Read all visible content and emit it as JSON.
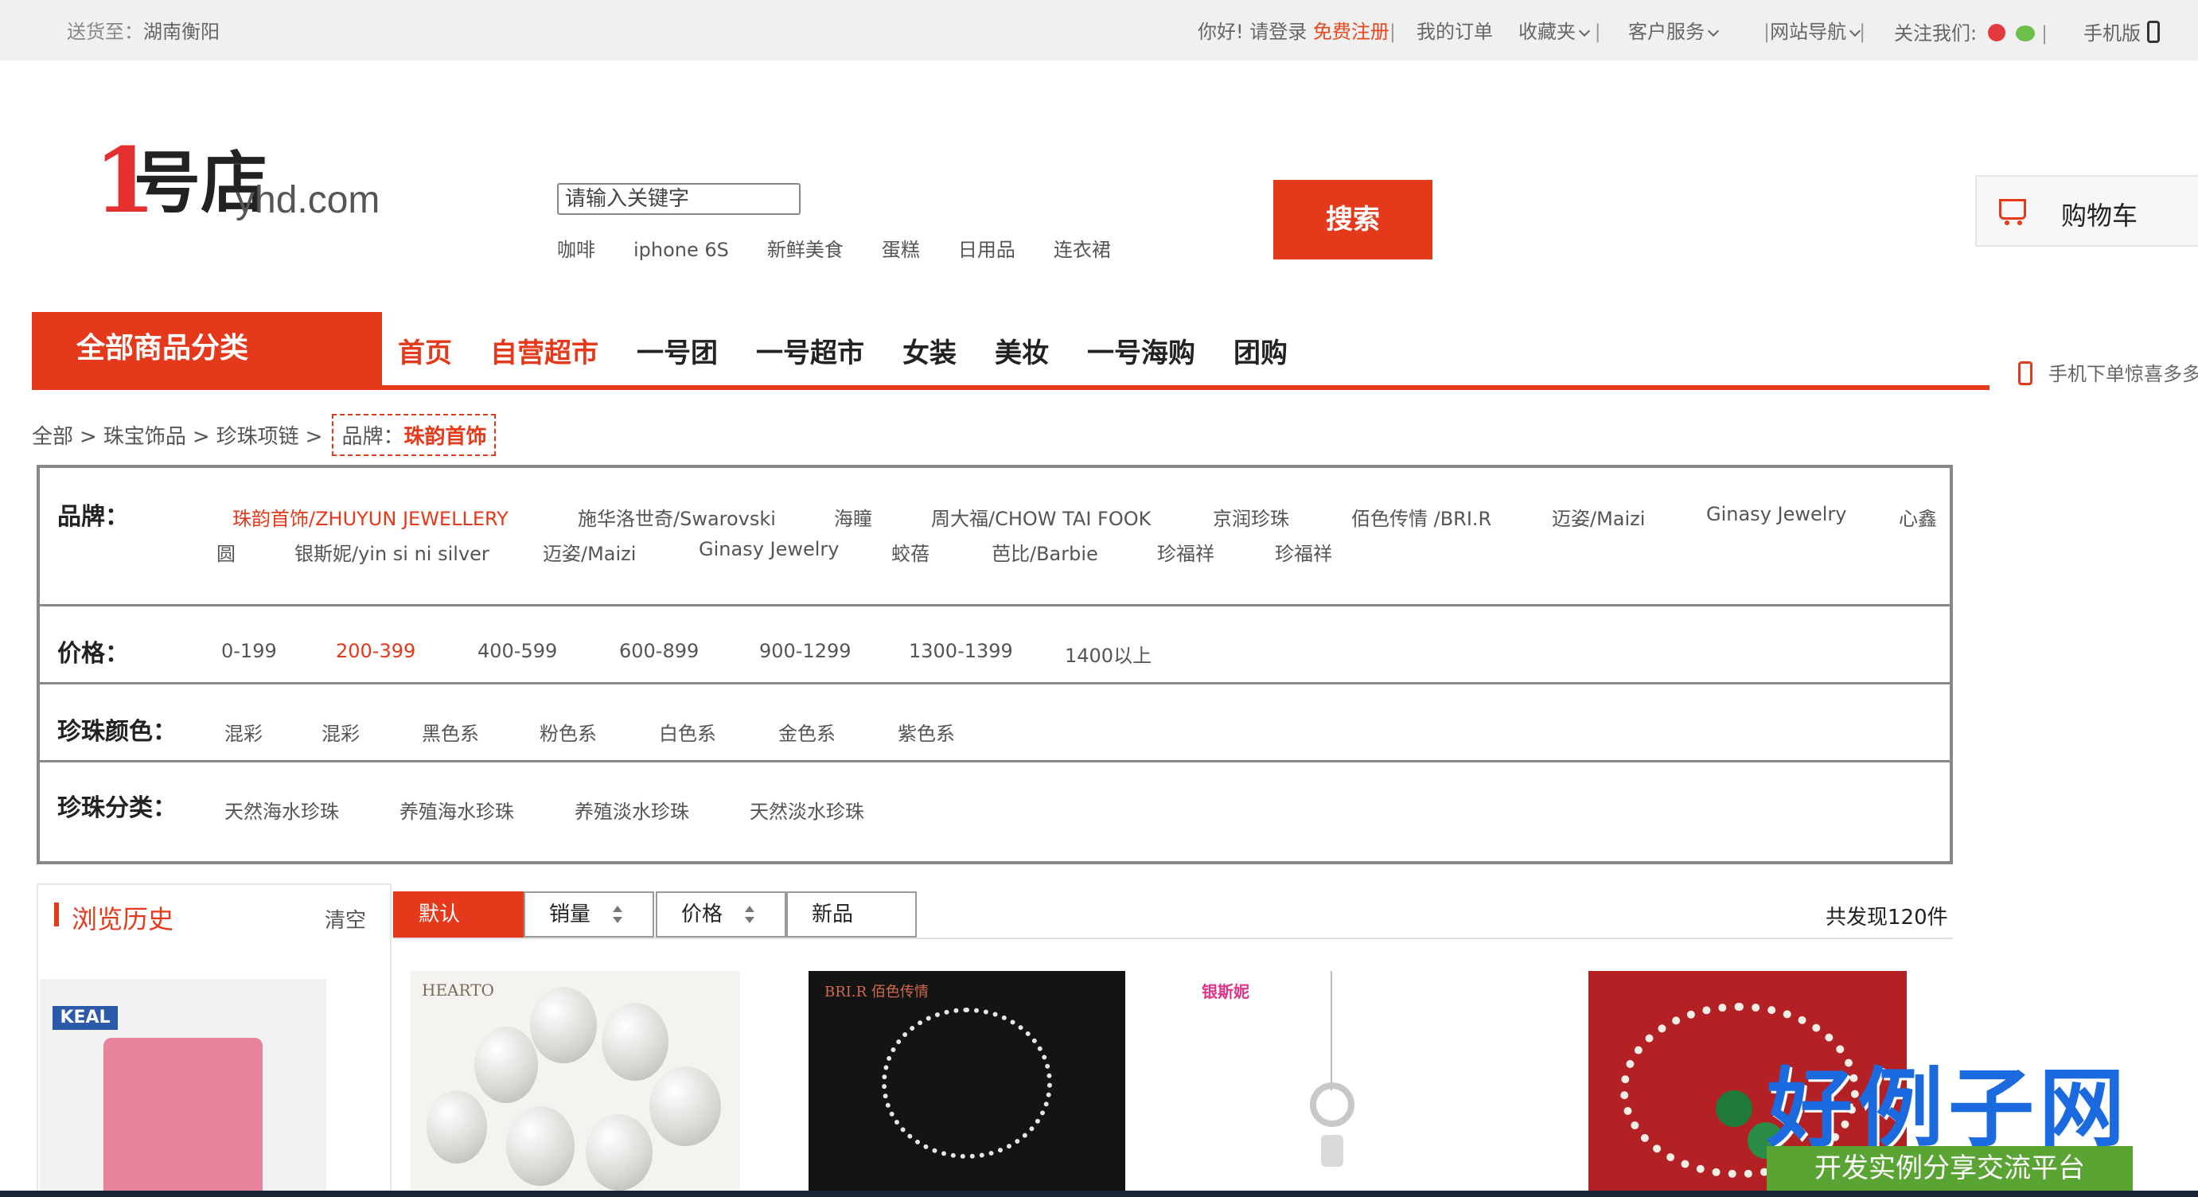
{
  "topbar": {
    "deliver_label": "送货至：",
    "deliver_city": "湖南衡阳",
    "hello": "你好! 请登录",
    "register": "免费注册",
    "orders": "我的订单",
    "favorites": "收藏夹",
    "service": "客户服务",
    "site_nav": "网站导航",
    "follow": "关注我们:",
    "mobile": "手机版"
  },
  "header": {
    "logo_mark": "1",
    "logo_text": "号店",
    "logo_site": "yhd.com",
    "search_placeholder": "请输入关键字",
    "search_button": "搜索",
    "hotwords": [
      "咖啡",
      "iphone 6S",
      "新鲜美食",
      "蛋糕",
      "日用品",
      "连衣裙"
    ],
    "cart_label": "购物车",
    "promo": "手机下单惊喜多多"
  },
  "nav": {
    "all_categories": "全部商品分类",
    "links": [
      "首页",
      "自营超市",
      "一号团",
      "一号超市",
      "女装",
      "美妆",
      "一号海购",
      "团购"
    ]
  },
  "breadcrumb": {
    "items": [
      "全部",
      "珠宝饰品",
      "珍珠项链"
    ],
    "brand_label": "品牌：",
    "brand_value": "珠韵首饰"
  },
  "filters": {
    "brand_label": "品牌：",
    "brands": [
      "珠韵首饰/ZHUYUN JEWELLERY",
      "施华洛世奇/Swarovski",
      "海瞳",
      "周大福/CHOW TAI FOOK",
      "京润珍珠",
      "佰色传情 /BRI.R",
      "迈姿/Maizi",
      "Ginasy Jewelry",
      "心鑫",
      "圆",
      "银斯妮/yin si ni silver",
      "迈姿/Maizi",
      "Ginasy Jewelry",
      "蛟蓓",
      "芭比/Barbie",
      "珍福祥",
      "珍福祥"
    ],
    "price_label": "价格：",
    "prices": [
      "0-199",
      "200-399",
      "400-599",
      "600-899",
      "900-1299",
      "1300-1399",
      "1400以上"
    ],
    "color_label": "珍珠颜色：",
    "colors": [
      "混彩",
      "混彩",
      "黑色系",
      "粉色系",
      "白色系",
      "金色系",
      "紫色系"
    ],
    "type_label": "珍珠分类：",
    "types": [
      "天然海水珍珠",
      "养殖海水珍珠",
      "养殖淡水珍珠",
      "天然淡水珍珠"
    ]
  },
  "history": {
    "title": "浏览历史",
    "clear": "清空",
    "thumb_brand": "KEAL"
  },
  "sort": {
    "default": "默认",
    "sales": "销量",
    "price": "价格",
    "new": "新品",
    "found": "共发现120件"
  },
  "products": [
    {
      "brand": "HEARTO"
    },
    {
      "brand": "BRI.R 佰色传情"
    },
    {
      "brand": "银斯妮"
    },
    {
      "brand": ""
    }
  ],
  "watermark": {
    "title": "好例子网",
    "subtitle": "开发实例分享交流平台"
  },
  "colors": {
    "accent": "#e5391b",
    "topbar_bg": "#f0f0f0"
  }
}
